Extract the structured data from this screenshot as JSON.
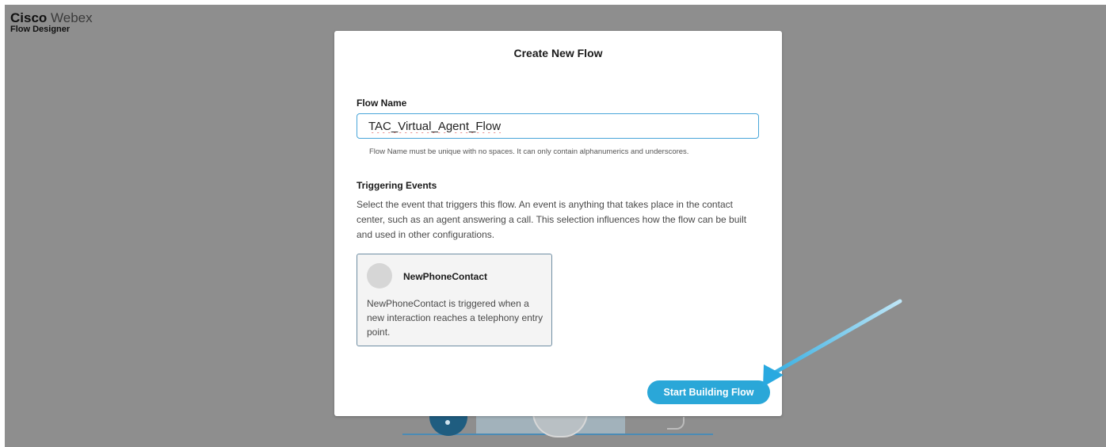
{
  "app": {
    "brand_bold": "Cisco",
    "brand_light": "Webex",
    "subtitle": "Flow Designer"
  },
  "modal": {
    "title": "Create New Flow",
    "flow_name": {
      "label": "Flow Name",
      "value": "TAC_Virtual_Agent_Flow",
      "hint": "Flow Name must be unique with no spaces. It can only contain alphanumerics and underscores."
    },
    "triggering_events": {
      "label": "Triggering Events",
      "description": "Select the event that triggers this flow. An event is anything that takes place in the contact center, such as an agent answering a call. This selection influences how the flow can be built and used in other configurations.",
      "event": {
        "name": "NewPhoneContact",
        "description": "NewPhoneContact is triggered when a new interaction reaches a telephony entry point."
      }
    },
    "primary_button_label": "Start Building Flow"
  },
  "colors": {
    "backdrop": "#8e8e8e",
    "accent": "#2aa7d8",
    "input_border": "#49a6d9",
    "card_border": "#6f8ea3",
    "annotation_arrow": "#29a9e0"
  },
  "icons": {
    "event_avatar": "avatar-placeholder-icon",
    "annotation": "pointer-arrow-icon"
  }
}
